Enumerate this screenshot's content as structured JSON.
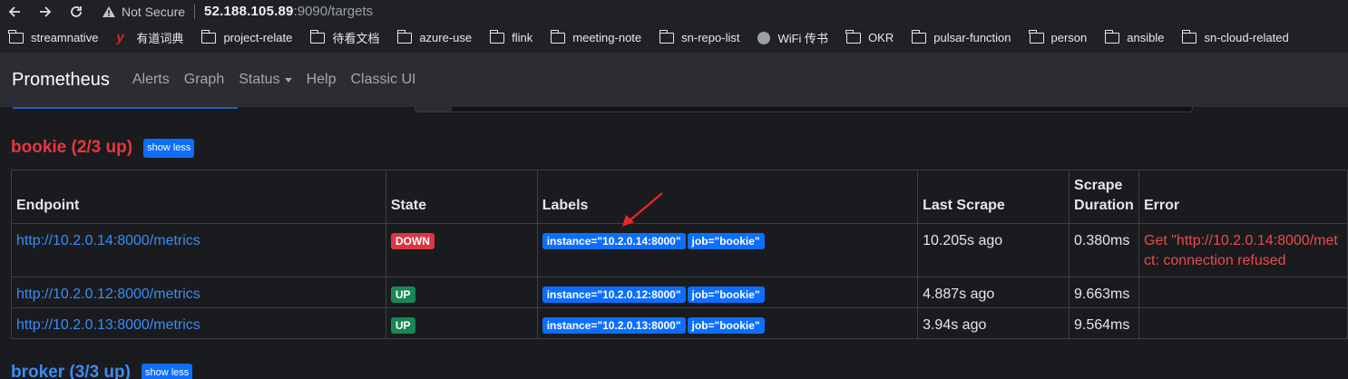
{
  "browser": {
    "security_label": "Not Secure",
    "url_host": "52.188.105.89",
    "url_rest": ":9090/targets",
    "bookmarks": [
      {
        "label": "streamnative",
        "icon": "folder-icon"
      },
      {
        "label": "有道词典",
        "icon": "youdao-icon"
      },
      {
        "label": "project-relate",
        "icon": "folder-icon"
      },
      {
        "label": "待看文档",
        "icon": "folder-icon"
      },
      {
        "label": "azure-use",
        "icon": "folder-icon"
      },
      {
        "label": "flink",
        "icon": "folder-icon"
      },
      {
        "label": "meeting-note",
        "icon": "folder-icon"
      },
      {
        "label": "sn-repo-list",
        "icon": "folder-icon"
      },
      {
        "label": "WiFi 传书",
        "icon": "globe-icon"
      },
      {
        "label": "OKR",
        "icon": "folder-icon"
      },
      {
        "label": "pulsar-function",
        "icon": "folder-icon"
      },
      {
        "label": "person",
        "icon": "folder-icon"
      },
      {
        "label": "ansible",
        "icon": "folder-icon"
      },
      {
        "label": "sn-cloud-related",
        "icon": "folder-icon"
      }
    ]
  },
  "navbar": {
    "brand": "Prometheus",
    "links": {
      "alerts": "Alerts",
      "graph": "Graph",
      "status": "Status",
      "help": "Help",
      "classic": "Classic UI"
    }
  },
  "sections": {
    "bookie": {
      "title": "bookie (2/3 up)",
      "title_color": "#e8363f",
      "toggle_label": "show less"
    },
    "broker": {
      "title": "broker (3/3 up)",
      "title_color": "#3a8cf3",
      "toggle_label": "show less"
    }
  },
  "table": {
    "headers": {
      "endpoint": "Endpoint",
      "state": "State",
      "labels": "Labels",
      "last_scrape": "Last Scrape",
      "duration_line1": "Scrape",
      "duration_line2": "Duration",
      "error": "Error"
    },
    "rows": [
      {
        "endpoint": "http://10.2.0.14:8000/metrics",
        "state": "DOWN",
        "instance_label": "instance=\"10.2.0.14:8000\"",
        "job_label": "job=\"bookie\"",
        "last_scrape": "10.205s ago",
        "duration": "0.380ms",
        "error_line1": "Get \"http://10.2.0.14:8000/met",
        "error_line2": "ct: connection refused"
      },
      {
        "endpoint": "http://10.2.0.12:8000/metrics",
        "state": "UP",
        "instance_label": "instance=\"10.2.0.12:8000\"",
        "job_label": "job=\"bookie\"",
        "last_scrape": "4.887s ago",
        "duration": "9.663ms",
        "error_line1": "",
        "error_line2": ""
      },
      {
        "endpoint": "http://10.2.0.13:8000/metrics",
        "state": "UP",
        "instance_label": "instance=\"10.2.0.13:8000\"",
        "job_label": "job=\"bookie\"",
        "last_scrape": "3.94s ago",
        "duration": "9.564ms",
        "error_line1": "",
        "error_line2": ""
      }
    ]
  },
  "colors": {
    "down": "#dc3545",
    "up": "#198754",
    "label_blue": "#0d6efd",
    "annotation_arrow": "#e8262b"
  }
}
